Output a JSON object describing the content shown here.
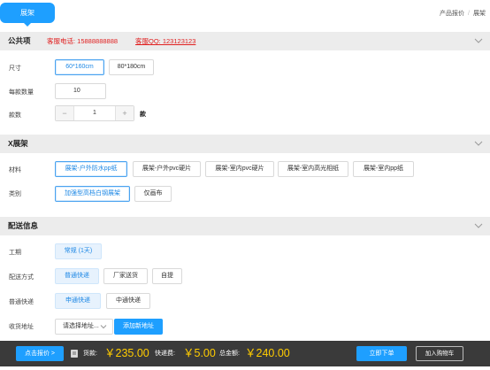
{
  "header": {
    "tab_label": "展架",
    "breadcrumb": [
      "产品报价",
      "展架"
    ]
  },
  "public_section": {
    "title": "公共项",
    "phone": "客服电话: 15888888888",
    "qq": "客服QQ: 123123123",
    "size_label": "尺寸",
    "sizes": [
      "60*160cm",
      "80*180cm"
    ],
    "selected_size": "60*160cm",
    "per_qty_label": "每款数量",
    "per_qty_value": "10",
    "count_label": "款数",
    "count_value": "1",
    "count_unit": "款",
    "minus": "−",
    "plus": "+"
  },
  "x_section": {
    "title": "X展架",
    "material_label": "材料",
    "materials": [
      "展架-户外防水pp纸",
      "展架-户外pvc硬片",
      "展架-室内pvc硬片",
      "展架-室内高光相纸",
      "展架-室内pp纸"
    ],
    "selected_material": "展架-户外防水pp纸",
    "type_label": "类别",
    "types": [
      "加强型高档白钢展架",
      "仅画布"
    ],
    "selected_type": "加强型高档白钢展架"
  },
  "delivery_section": {
    "title": "配送信息",
    "period_label": "工期",
    "period_value": "常规 (1天)",
    "method_label": "配送方式",
    "methods": [
      "普通快递",
      "厂家送货",
      "自提"
    ],
    "selected_method": "普通快递",
    "express_label": "普通快递",
    "express_options": [
      "申通快递",
      "中通快递"
    ],
    "selected_express": "申通快递",
    "address_label": "收货地址",
    "address_placeholder": "请选择地址...",
    "add_address": "添加新地址"
  },
  "bottom_bar": {
    "quote_button": "点击报价 >",
    "goods_label": "货款:",
    "goods_price": "￥235.00",
    "shipping_label": "快递费:",
    "shipping_price": "￥5.00",
    "total_label": "总金额:",
    "total_price": "￥240.00",
    "order_button": "立即下单",
    "cart_button": "加入购物车"
  },
  "colors": {
    "accent": "#1e9fff",
    "price": "#ffcc00",
    "contact": "#e02020",
    "bar": "#3a3a3a"
  }
}
